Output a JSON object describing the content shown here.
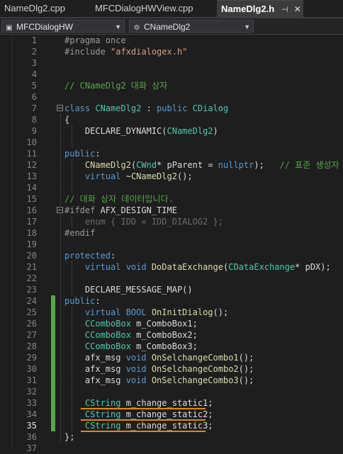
{
  "tabs": [
    {
      "label": "NameDlg2.cpp",
      "active": false
    },
    {
      "label": "MFCDialogHWView.cpp",
      "active": false
    },
    {
      "label": "NameDlg2.h",
      "active": true,
      "pin": "⊣",
      "close": "✕"
    }
  ],
  "navbar": {
    "project": "MFCDialogHW",
    "scope": "CNameDlg2",
    "project_icon": "project-icon",
    "class_icon": "class-icon"
  },
  "editor": {
    "current_line": 35,
    "lines": [
      {
        "n": "1",
        "tokens": [
          {
            "t": "#pragma once",
            "c": "#9b9b9b"
          }
        ]
      },
      {
        "n": "2",
        "tokens": [
          {
            "t": "#include ",
            "c": "#9b9b9b"
          },
          {
            "t": "\"afxdialogex.h\"",
            "c": "#d69d85"
          }
        ]
      },
      {
        "n": "3",
        "tokens": []
      },
      {
        "n": "4",
        "tokens": []
      },
      {
        "n": "5",
        "tokens": [
          {
            "t": "// CNameDlg2 대화 상자",
            "c": "#57a64a"
          }
        ]
      },
      {
        "n": "6",
        "tokens": []
      },
      {
        "n": "7",
        "tokens": [
          {
            "t": "class ",
            "c": "#569cd6"
          },
          {
            "t": "CNameDlg2",
            "c": "#4ec9b0"
          },
          {
            "t": " : ",
            "c": "#dcdcdc"
          },
          {
            "t": "public ",
            "c": "#569cd6"
          },
          {
            "t": "CDialog",
            "c": "#4ec9b0"
          }
        ]
      },
      {
        "n": "8",
        "tokens": [
          {
            "t": "{",
            "c": "#dcdcdc"
          }
        ]
      },
      {
        "n": "9",
        "tokens": [
          {
            "t": "    DECLARE_DYNAMIC(",
            "c": "#dcdcdc"
          },
          {
            "t": "CNameDlg2",
            "c": "#4ec9b0"
          },
          {
            "t": ")",
            "c": "#dcdcdc"
          }
        ]
      },
      {
        "n": "10",
        "tokens": []
      },
      {
        "n": "11",
        "tokens": [
          {
            "t": "public",
            "c": "#569cd6"
          },
          {
            "t": ":",
            "c": "#dcdcdc"
          }
        ]
      },
      {
        "n": "12",
        "tokens": [
          {
            "t": "    ",
            "c": "#dcdcdc"
          },
          {
            "t": "CNameDlg2",
            "c": "#dcdcaa"
          },
          {
            "t": "(",
            "c": "#dcdcdc"
          },
          {
            "t": "CWnd",
            "c": "#4ec9b0"
          },
          {
            "t": "* pParent = ",
            "c": "#dcdcdc"
          },
          {
            "t": "nullptr",
            "c": "#569cd6"
          },
          {
            "t": ");   ",
            "c": "#dcdcdc"
          },
          {
            "t": "// 표준 생성자",
            "c": "#57a64a"
          }
        ]
      },
      {
        "n": "13",
        "tokens": [
          {
            "t": "    ",
            "c": "#dcdcdc"
          },
          {
            "t": "virtual ",
            "c": "#569cd6"
          },
          {
            "t": "~",
            "c": "#dcdcdc"
          },
          {
            "t": "CNameDlg2",
            "c": "#dcdcaa"
          },
          {
            "t": "();",
            "c": "#dcdcdc"
          }
        ]
      },
      {
        "n": "14",
        "tokens": []
      },
      {
        "n": "15",
        "tokens": [
          {
            "t": "// 대화 상자 데이터입니다.",
            "c": "#57a64a"
          }
        ]
      },
      {
        "n": "16",
        "tokens": [
          {
            "t": "#ifdef ",
            "c": "#9b9b9b"
          },
          {
            "t": "AFX_DESIGN_TIME",
            "c": "#dcdcdc"
          }
        ]
      },
      {
        "n": "17",
        "tokens": [
          {
            "t": "    enum { IDD = IDD_DIALOG2 };",
            "c": "#6c6c6c"
          }
        ]
      },
      {
        "n": "18",
        "tokens": [
          {
            "t": "#endif",
            "c": "#9b9b9b"
          }
        ]
      },
      {
        "n": "19",
        "tokens": []
      },
      {
        "n": "20",
        "tokens": [
          {
            "t": "protected",
            "c": "#569cd6"
          },
          {
            "t": ":",
            "c": "#dcdcdc"
          }
        ]
      },
      {
        "n": "21",
        "tokens": [
          {
            "t": "    ",
            "c": "#dcdcdc"
          },
          {
            "t": "virtual ",
            "c": "#569cd6"
          },
          {
            "t": "void ",
            "c": "#569cd6"
          },
          {
            "t": "DoDataExchange",
            "c": "#dcdcaa"
          },
          {
            "t": "(",
            "c": "#dcdcdc"
          },
          {
            "t": "CDataExchange",
            "c": "#4ec9b0"
          },
          {
            "t": "* pDX);",
            "c": "#dcdcdc"
          }
        ]
      },
      {
        "n": "22",
        "tokens": []
      },
      {
        "n": "23",
        "tokens": [
          {
            "t": "    DECLARE_MESSAGE_MAP()",
            "c": "#dcdcdc"
          }
        ]
      },
      {
        "n": "24",
        "tokens": [
          {
            "t": "public",
            "c": "#569cd6"
          },
          {
            "t": ":",
            "c": "#dcdcdc"
          }
        ]
      },
      {
        "n": "25",
        "tokens": [
          {
            "t": "    ",
            "c": "#dcdcdc"
          },
          {
            "t": "virtual ",
            "c": "#569cd6"
          },
          {
            "t": "BOOL ",
            "c": "#569cd6"
          },
          {
            "t": "OnInitDialog",
            "c": "#dcdcaa"
          },
          {
            "t": "();",
            "c": "#dcdcdc"
          }
        ]
      },
      {
        "n": "26",
        "tokens": [
          {
            "t": "    ",
            "c": "#dcdcdc"
          },
          {
            "t": "CComboBox",
            "c": "#4ec9b0"
          },
          {
            "t": " m_ComboBox1;",
            "c": "#dcdcdc"
          }
        ]
      },
      {
        "n": "27",
        "tokens": [
          {
            "t": "    ",
            "c": "#dcdcdc"
          },
          {
            "t": "CComboBox",
            "c": "#4ec9b0"
          },
          {
            "t": " m_ComboBox2;",
            "c": "#dcdcdc"
          }
        ]
      },
      {
        "n": "28",
        "tokens": [
          {
            "t": "    ",
            "c": "#dcdcdc"
          },
          {
            "t": "CComboBox",
            "c": "#4ec9b0"
          },
          {
            "t": " m_ComboBox3;",
            "c": "#dcdcdc"
          }
        ]
      },
      {
        "n": "29",
        "tokens": [
          {
            "t": "    afx_msg ",
            "c": "#dcdcdc"
          },
          {
            "t": "void ",
            "c": "#569cd6"
          },
          {
            "t": "OnSelchangeCombo1",
            "c": "#dcdcaa"
          },
          {
            "t": "();",
            "c": "#dcdcdc"
          }
        ]
      },
      {
        "n": "30",
        "tokens": [
          {
            "t": "    afx_msg ",
            "c": "#dcdcdc"
          },
          {
            "t": "void ",
            "c": "#569cd6"
          },
          {
            "t": "OnSelchangeCombo2",
            "c": "#dcdcaa"
          },
          {
            "t": "();",
            "c": "#dcdcdc"
          }
        ]
      },
      {
        "n": "31",
        "tokens": [
          {
            "t": "    afx_msg ",
            "c": "#dcdcdc"
          },
          {
            "t": "void ",
            "c": "#569cd6"
          },
          {
            "t": "OnSelchangeCombo3",
            "c": "#dcdcaa"
          },
          {
            "t": "();",
            "c": "#dcdcdc"
          }
        ]
      },
      {
        "n": "32",
        "tokens": []
      },
      {
        "n": "33",
        "tokens": [
          {
            "t": "    ",
            "c": "#dcdcdc"
          },
          {
            "t": "CString",
            "c": "#4ec9b0"
          },
          {
            "t": " m_change_static1;",
            "c": "#dcdcdc"
          }
        ]
      },
      {
        "n": "34",
        "tokens": [
          {
            "t": "    ",
            "c": "#dcdcdc"
          },
          {
            "t": "CString",
            "c": "#4ec9b0"
          },
          {
            "t": " m_change_static2;",
            "c": "#dcdcdc"
          }
        ]
      },
      {
        "n": "35",
        "tokens": [
          {
            "t": "    ",
            "c": "#dcdcdc"
          },
          {
            "t": "CString",
            "c": "#4ec9b0"
          },
          {
            "t": " m_change_static3;",
            "c": "#dcdcdc"
          }
        ]
      },
      {
        "n": "36",
        "tokens": [
          {
            "t": "};",
            "c": "#dcdcdc"
          }
        ]
      },
      {
        "n": "37",
        "tokens": []
      }
    ]
  },
  "annotation_color": "#e8860c",
  "change_marker_color": "#57a64a"
}
